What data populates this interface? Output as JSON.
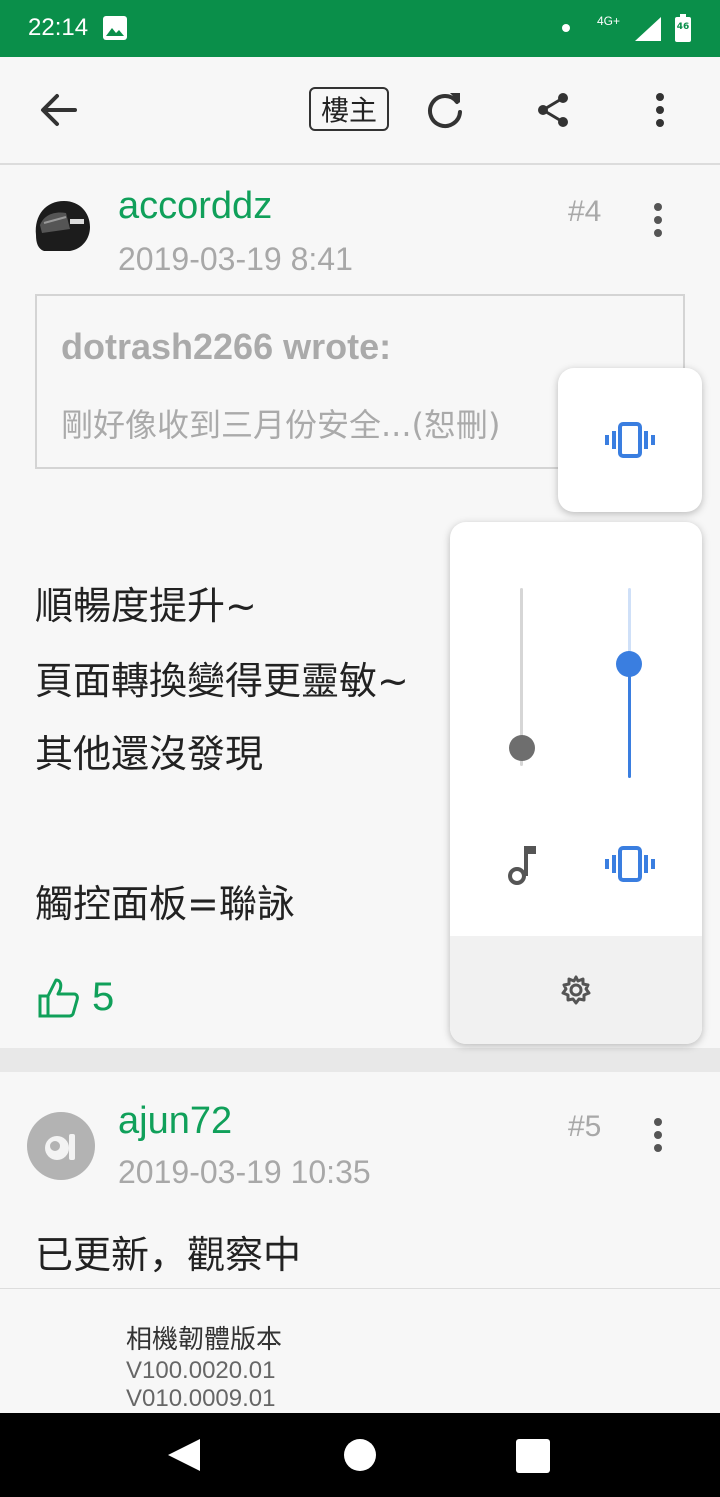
{
  "status_bar": {
    "time": "22:14",
    "network": "4G+",
    "battery_level": "46",
    "icons": [
      "image-icon",
      "notification-dot-icon",
      "signal-icon",
      "battery-icon"
    ]
  },
  "toolbar": {
    "author_only_label": "樓主",
    "icons": [
      "back-arrow-icon",
      "refresh-icon",
      "share-icon",
      "more-vert-icon"
    ]
  },
  "posts": [
    {
      "username": "accorddz",
      "date": "2019-03-19 8:41",
      "floor": "#4",
      "quote": {
        "author": "dotrash2266 wrote:",
        "text": "剛好像收到三月份安全...(恕刪)"
      },
      "body_lines": [
        "順暢度提升~",
        "頁面轉換變得更靈敏~",
        "其他還沒發現",
        "",
        "觸控面板=聯詠"
      ],
      "likes": "5"
    },
    {
      "username": "ajun72",
      "date": "2019-03-19 10:35",
      "floor": "#5",
      "body_lines": [
        "已更新，觀察中"
      ]
    }
  ],
  "attachment": {
    "title": "相機韌體版本",
    "lines": [
      "V100.0020.01",
      "V010.0009.01"
    ]
  },
  "volume_panel": {
    "media_level": 0.1,
    "ring_level": 0.6,
    "ringer_mode": "vibrate",
    "accent_color": "#3a7ee0",
    "icons": [
      "vibrate-icon",
      "music-note-icon",
      "vibrate-icon",
      "settings-gear-icon"
    ]
  },
  "colors": {
    "status_bar": "#0a8f4a",
    "username": "#10a05a",
    "accent": "#3a7ee0"
  }
}
